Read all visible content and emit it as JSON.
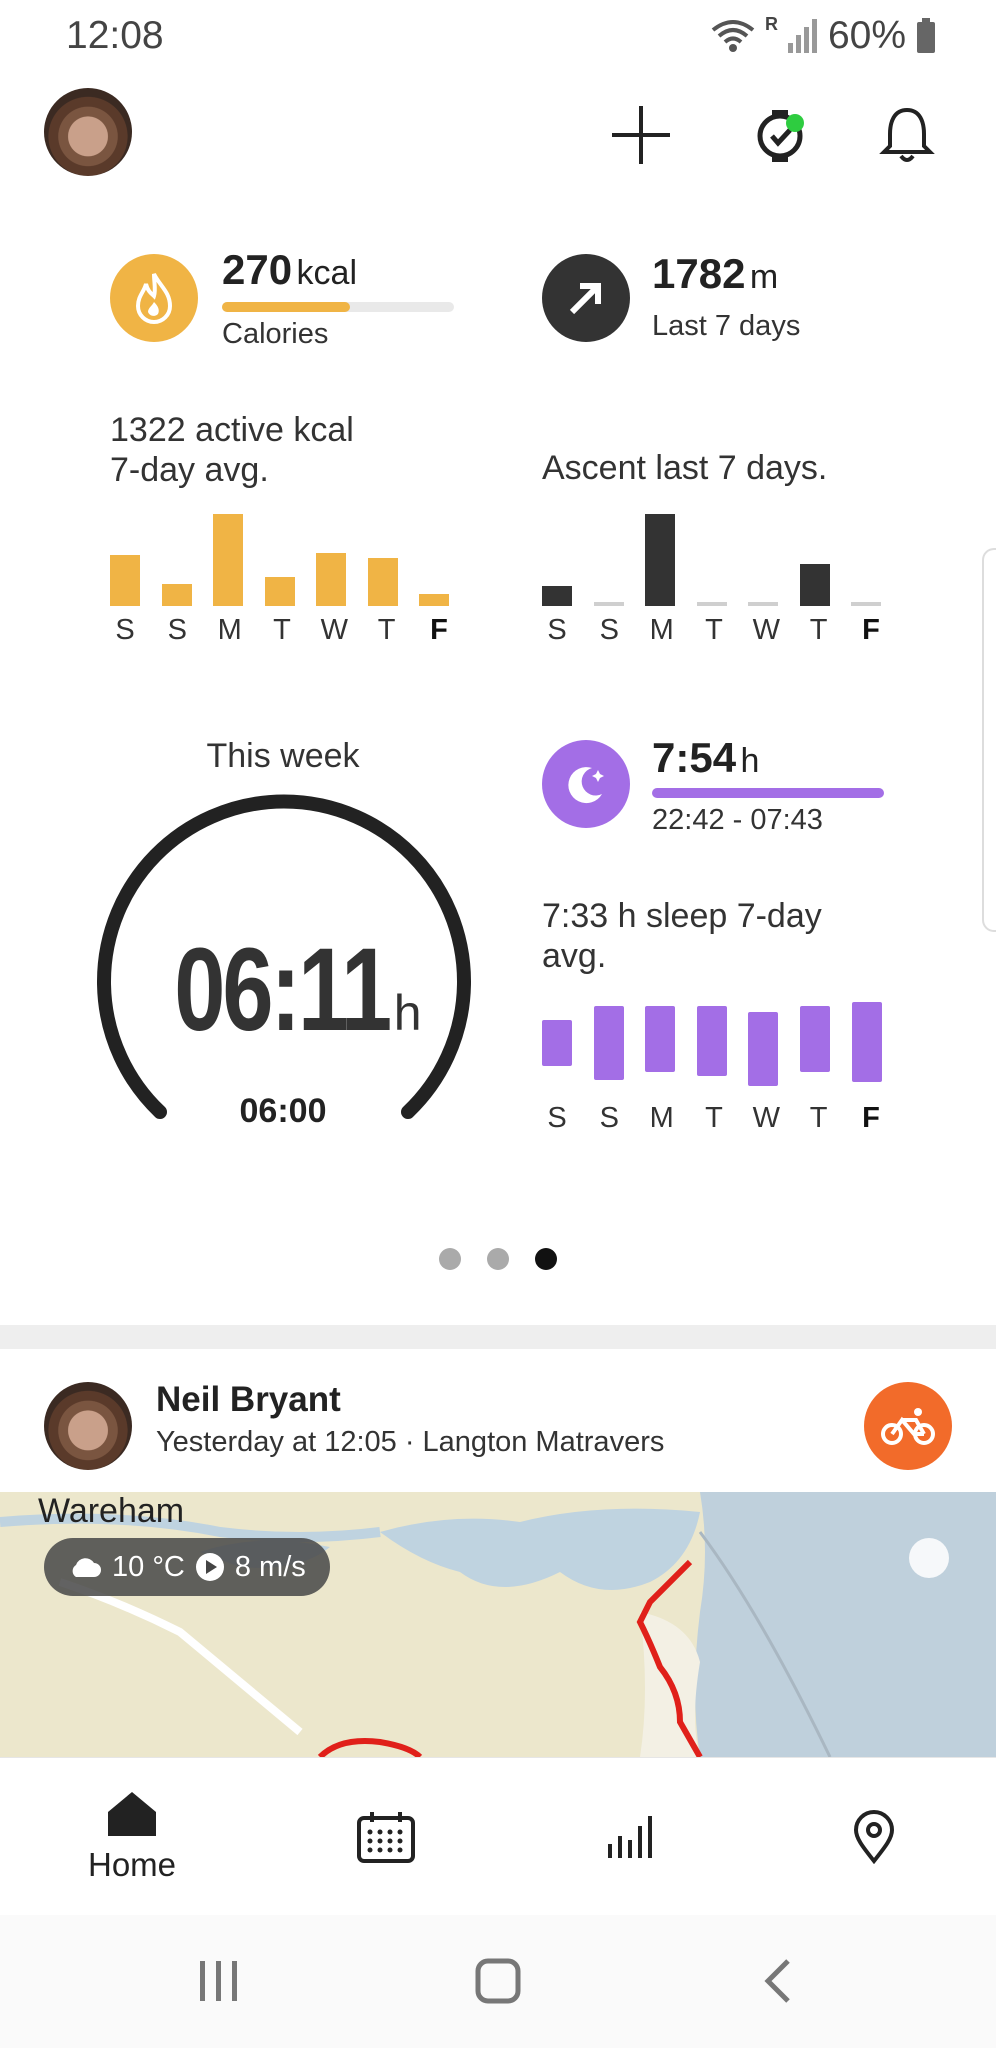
{
  "status_bar": {
    "time": "12:08",
    "battery": "60%",
    "network": "R"
  },
  "calories": {
    "value": "270",
    "unit": "kcal",
    "label": "Calories",
    "progress": 0.55,
    "summary": "1322 active kcal\n7-day avg.",
    "days": [
      "S",
      "S",
      "M",
      "T",
      "W",
      "T",
      "F"
    ],
    "values": [
      0.55,
      0.24,
      1.0,
      0.32,
      0.58,
      0.52,
      0.12
    ],
    "color": "#f0b445"
  },
  "ascent": {
    "value": "1782",
    "unit": "m",
    "label": "Last 7 days",
    "summary": "Ascent last 7 days.",
    "days": [
      "S",
      "S",
      "M",
      "T",
      "W",
      "T",
      "F"
    ],
    "values": [
      0.22,
      0.0,
      1.0,
      0.0,
      0.0,
      0.46,
      0.0
    ],
    "color": "#333333"
  },
  "week": {
    "title": "This week",
    "value": "06:11",
    "unit": "h",
    "target": "06:00"
  },
  "sleep": {
    "value": "7:54",
    "unit": "h",
    "range": "22:42 - 07:43",
    "summary": "7:33 h sleep 7-day\navg.",
    "days": [
      "S",
      "S",
      "M",
      "T",
      "W",
      "T",
      "F"
    ],
    "color": "#a36ee6"
  },
  "pager": {
    "count": 3,
    "active": 2
  },
  "feed": {
    "name": "Neil Bryant",
    "meta": "Yesterday at 12:05 · Langton Matravers",
    "map_place": "Wareham",
    "weather": "10 °C",
    "wind": "8 m/s"
  },
  "bottom_nav": {
    "home_label": "Home"
  }
}
